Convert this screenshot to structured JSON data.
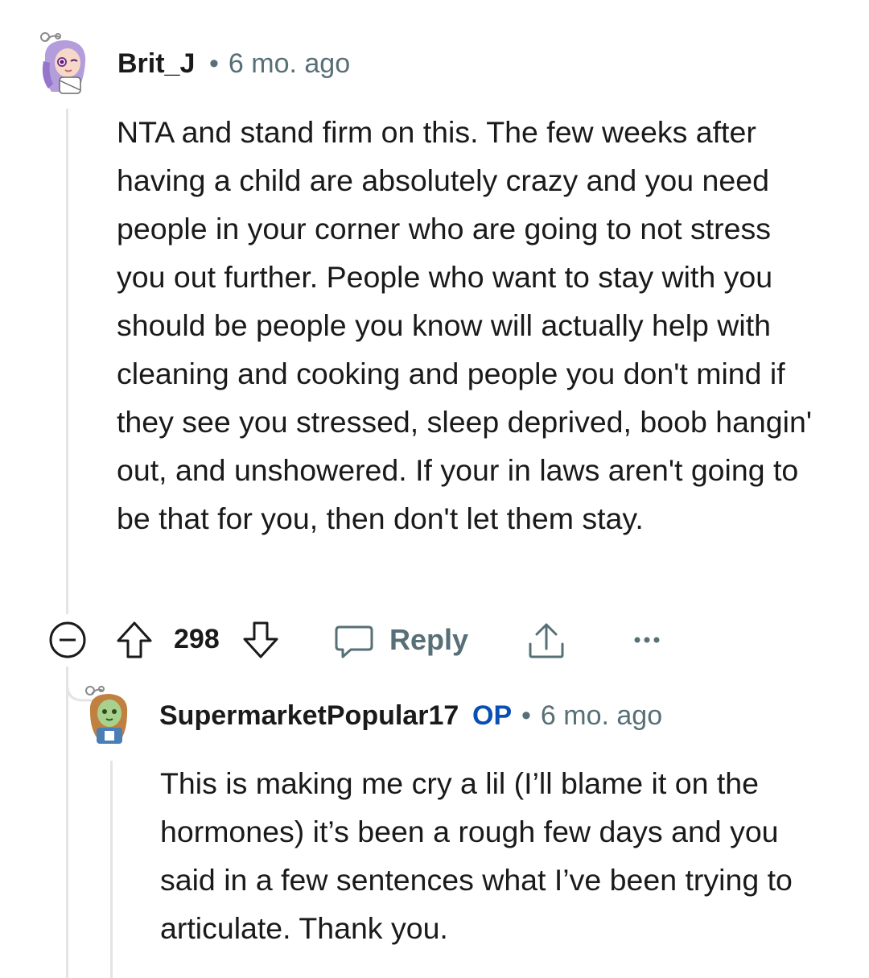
{
  "comment": {
    "username": "Brit_J",
    "time": "6 mo. ago",
    "body": "NTA and stand firm on this. The few weeks after having a child are absolutely crazy and you need people in your corner who are going to not stress you out further. People who want to stay with you should be people you know will actually help with cleaning and cooking and people you don't mind if they see you stressed, sleep deprived, boob hangin' out, and unshowered. If your in laws aren't going to be that for you, then don't let them stay.",
    "votes": "298",
    "reply_label": "Reply",
    "avatar_icon": "avatar-purple-hair-icon"
  },
  "reply": {
    "username": "SupermarketPopular17",
    "op_badge": "OP",
    "time": "6 mo. ago",
    "body": "This is making me cry a lil (I’ll blame it on the hormones) it’s been a rough few days and you said in a few sentences what I’ve been trying to articulate. Thank you.",
    "avatar_icon": "avatar-brown-hair-icon"
  },
  "separator": "•",
  "colors": {
    "text": "#1a1a1b",
    "meta": "#576f76",
    "op": "#0a4fb3",
    "thread_line": "#e4e4e4"
  }
}
